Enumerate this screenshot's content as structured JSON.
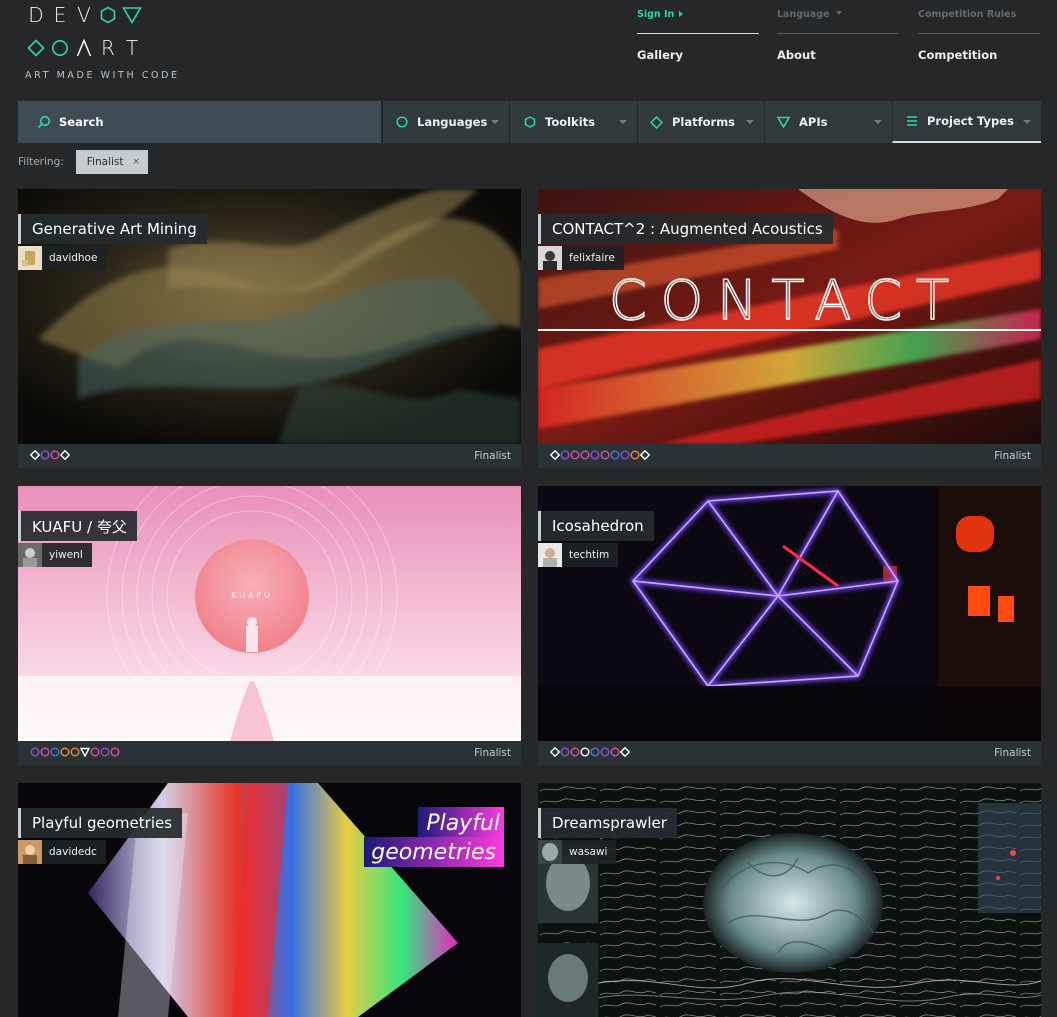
{
  "logo": {
    "word1": [
      "D",
      "E",
      "V"
    ],
    "word2": [
      "A",
      "R",
      "T"
    ],
    "tagline": "ART MADE WITH CODE",
    "accent": "#2fd6ab"
  },
  "topnav": {
    "signin": "Sign In",
    "language": "Language",
    "competition_rules": "Competition Rules",
    "gallery": "Gallery",
    "about": "About",
    "competition": "Competition"
  },
  "filters": {
    "search": "Search",
    "languages": "Languages",
    "toolkits": "Toolkits",
    "platforms": "Platforms",
    "apis": "APIs",
    "project_types": "Project Types"
  },
  "filtering": {
    "label": "Filtering:",
    "chip": "Finalist",
    "chip_close": "×"
  },
  "cards": [
    {
      "title": "Generative Art Mining",
      "author": "davidhoe",
      "status": "Finalist"
    },
    {
      "title": "CONTACT^2 : Augmented Acoustics",
      "author": "felixfaire",
      "status": "Finalist",
      "art_text": "CONTACT"
    },
    {
      "title": "KUAFU / 夸父",
      "author": "yiwenl",
      "status": "Finalist",
      "art_text": "KUAFU"
    },
    {
      "title": "Icosahedron",
      "author": "techtim",
      "status": "Finalist"
    },
    {
      "title": "Playful geometries",
      "author": "davidedc",
      "art_line1": "Playful",
      "art_line2": "geometries"
    },
    {
      "title": "Dreamsprawler",
      "author": "wasawi"
    }
  ],
  "colors": {
    "teal": "#2fd6ab",
    "pink": "#e04fa3",
    "purple": "#8c4fd6",
    "blue": "#3f7be0",
    "orange": "#f08a2a",
    "white": "#ffffff"
  }
}
